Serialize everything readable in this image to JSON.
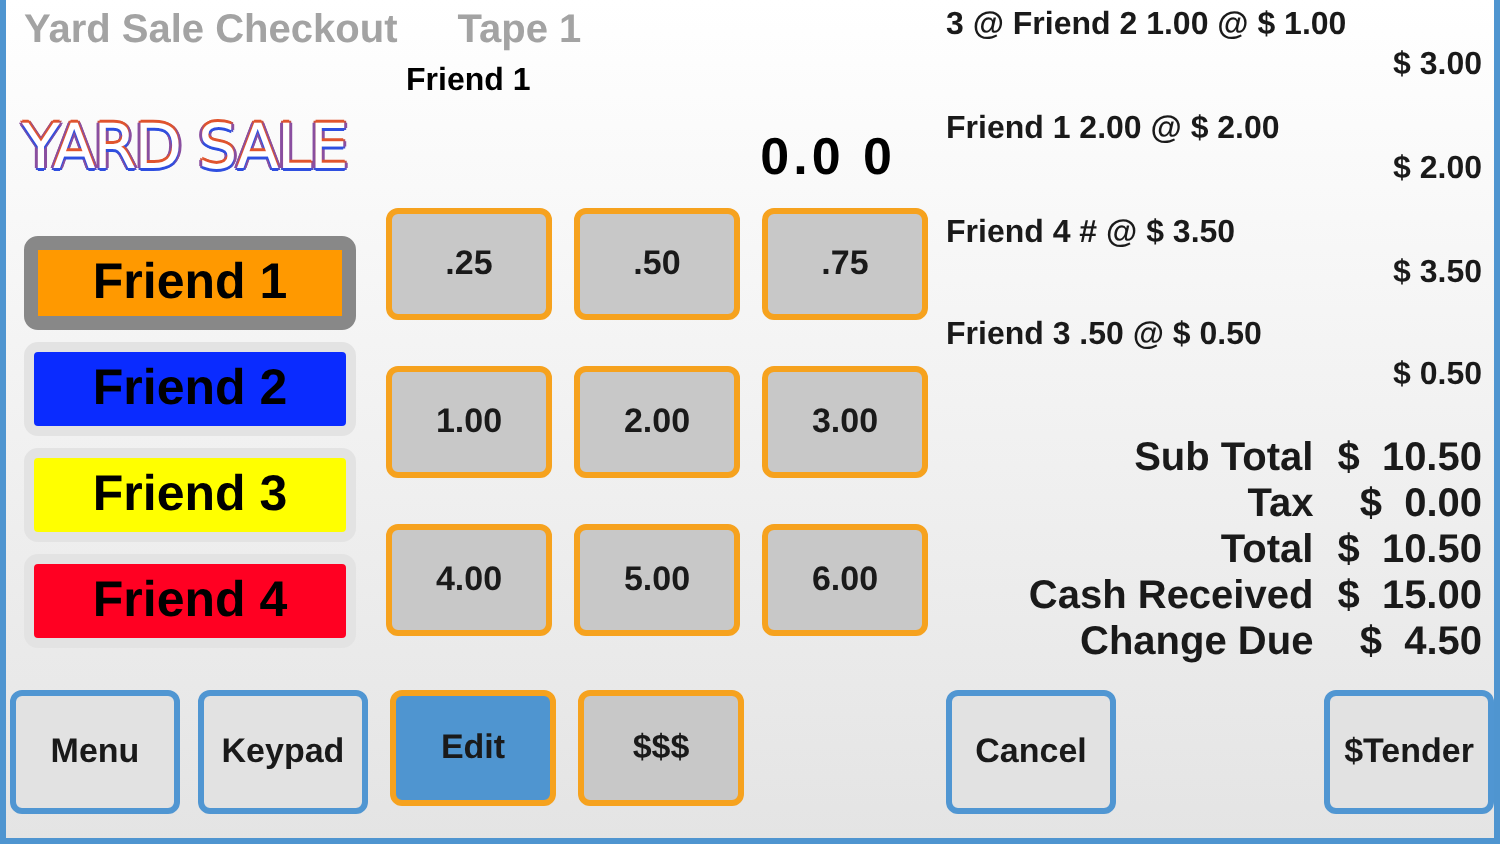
{
  "header": {
    "title": "Yard Sale Checkout",
    "tape": "Tape 1"
  },
  "logo": {
    "text": "YARD SALE"
  },
  "current_friend": "Friend 1",
  "display": "0.0 0",
  "friends": [
    {
      "label": "Friend 1",
      "color": "#ff9900",
      "selected": true
    },
    {
      "label": "Friend 2",
      "color": "#0a2bff",
      "selected": false
    },
    {
      "label": "Friend 3",
      "color": "#ffff00",
      "selected": false
    },
    {
      "label": "Friend 4",
      "color": "#ff0022",
      "selected": false
    }
  ],
  "keypad": [
    ".25",
    ".50",
    ".75",
    "1.00",
    "2.00",
    "3.00",
    "4.00",
    "5.00",
    "6.00"
  ],
  "receipt": {
    "items": [
      {
        "description": "3 @ Friend 2 1.00 @ $ 1.00",
        "amount": "$ 3.00"
      },
      {
        "description": "Friend 1 2.00 @ $ 2.00",
        "amount": "$ 2.00"
      },
      {
        "description": "Friend 4 #  @ $ 3.50",
        "amount": "$ 3.50"
      },
      {
        "description": "Friend 3 .50 @ $ 0.50",
        "amount": "$ 0.50"
      }
    ],
    "totals": [
      {
        "label": "Sub Total",
        "value": "$  10.50"
      },
      {
        "label": "Tax",
        "value": "$  0.00"
      },
      {
        "label": "Total",
        "value": "$  10.50"
      },
      {
        "label": "Cash Received",
        "value": "$  15.00"
      },
      {
        "label": "Change Due",
        "value": "$  4.50"
      }
    ]
  },
  "bottom_bar": {
    "left_buttons": [
      {
        "label": "Menu",
        "kind": "nav",
        "selected": false
      },
      {
        "label": "Keypad",
        "kind": "nav",
        "selected": false
      },
      {
        "label": "Edit",
        "kind": "key",
        "selected": true
      },
      {
        "label": "$$$",
        "kind": "key",
        "selected": false
      }
    ],
    "right_buttons": [
      {
        "label": "Cancel",
        "kind": "nav",
        "selected": false
      },
      {
        "label": "$Tender",
        "kind": "nav",
        "selected": false
      }
    ]
  }
}
